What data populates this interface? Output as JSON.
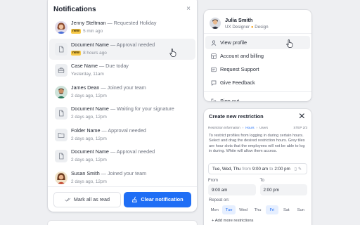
{
  "notifications": {
    "title": "Notifications",
    "close_glyph": "×",
    "items": [
      {
        "name": "Jenny Steltman",
        "action": "Requested Holiday",
        "time": "5 min ago",
        "badge": "new",
        "icon": "avatar-jenny"
      },
      {
        "name": "Document Name",
        "action": "Approval needed",
        "time": "8 hours ago",
        "badge": "new",
        "icon": "document-icon"
      },
      {
        "name": "Case Name",
        "action": "Due today",
        "time": "Yesterday, 11am",
        "icon": "briefcase-icon"
      },
      {
        "name": "James Dean",
        "action": "Joined your team",
        "time": "2 days ago, 12pm",
        "icon": "avatar-james"
      },
      {
        "name": "Document Name",
        "action": "Waiting for your signature",
        "time": "2 days ago, 12pm",
        "icon": "document-icon"
      },
      {
        "name": "Folder Name",
        "action": "Approval needed",
        "time": "2 days ago, 12pm",
        "icon": "folder-icon"
      },
      {
        "name": "Document Name",
        "action": "Approval needed",
        "time": "2 days ago, 12pm",
        "icon": "document-icon"
      },
      {
        "name": "Susan Smith",
        "action": "Joined your team",
        "time": "2 days ago, 12pm",
        "icon": "avatar-susan"
      }
    ],
    "separator": "—",
    "mark_all_label": "Mark all as read",
    "clear_label": "Clear notification"
  },
  "profile": {
    "name": "Julia Smith",
    "role": "UX Designer",
    "dept": "Design",
    "menu": [
      {
        "label": "View profile",
        "icon": "user-icon"
      },
      {
        "label": "Account and billing",
        "icon": "grid-icon"
      },
      {
        "label": "Request Support",
        "icon": "card-icon"
      },
      {
        "label": "Give Feedback",
        "icon": "feedback-icon"
      },
      {
        "label": "Sign out",
        "icon": "signout-icon"
      }
    ]
  },
  "restriction": {
    "title": "Create new restriction",
    "close_glyph": "×",
    "steps": [
      "Restriction information",
      "Hours",
      "Users"
    ],
    "step_counter": "STEP 2/3",
    "description": "To restrict profiles from logging in during certain hours. Select and drag the desired restriction hours. Grey tiles are hour slots that the employees will not be able to log in during. White will allow them access.",
    "range": {
      "day": "Tue, Wed, Thu",
      "from_word": "from",
      "start": "9:00 am",
      "to_word": "to",
      "end": "2:00 pm"
    },
    "from_label": "From",
    "to_label": "To",
    "from_value": "9:00 am",
    "to_value": "2:00 pm",
    "repeat_label": "Repeat on:",
    "days": [
      {
        "label": "Mon",
        "selected": false
      },
      {
        "label": "Tue",
        "selected": true
      },
      {
        "label": "Wed",
        "selected": false
      },
      {
        "label": "Thu",
        "selected": false
      },
      {
        "label": "Fri",
        "selected": true
      },
      {
        "label": "Sat",
        "selected": false
      },
      {
        "label": "Sun",
        "selected": false
      }
    ],
    "add_more_label": "Add more restrictions"
  },
  "colors": {
    "primary": "#1f6ef5",
    "badge": "#f7c948",
    "dept_dot": "#f5a623"
  }
}
